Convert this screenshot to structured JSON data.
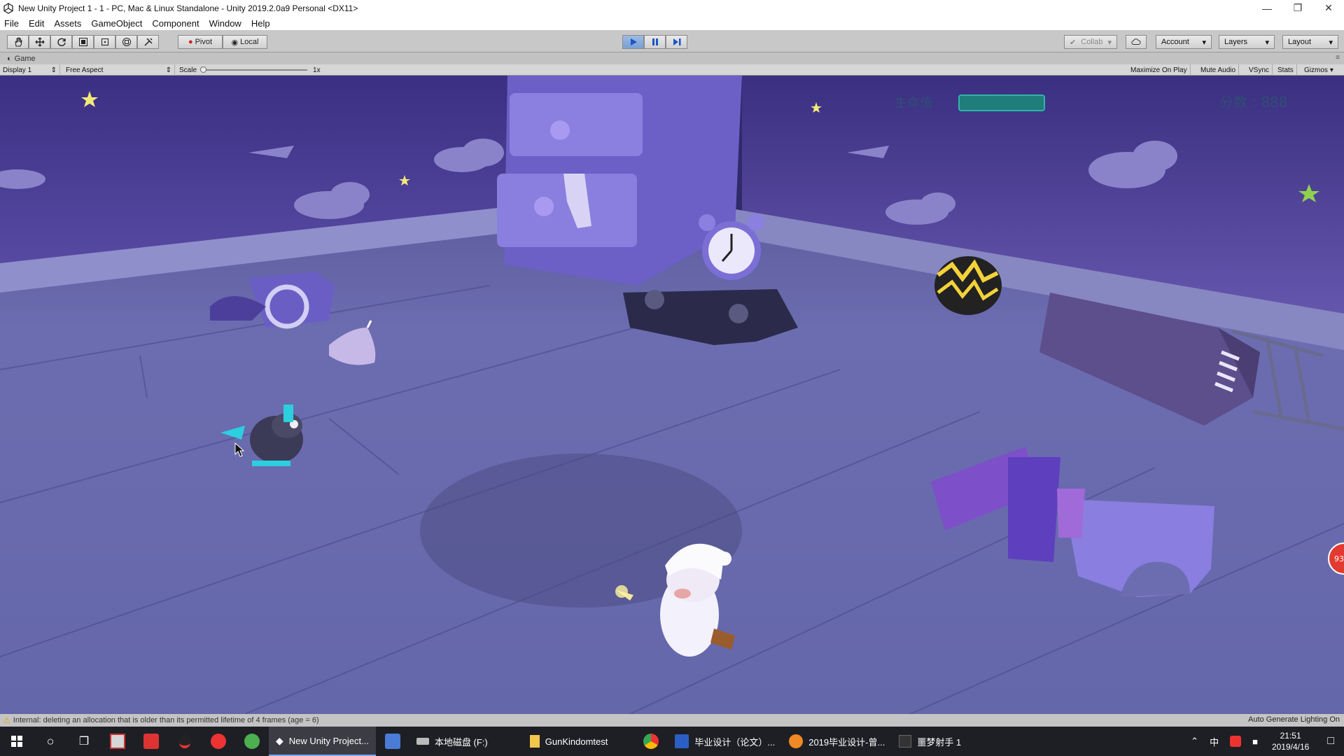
{
  "window": {
    "title": "New Unity Project 1 - 1 - PC, Mac & Linux Standalone - Unity 2019.2.0a9 Personal <DX11>",
    "minimize_icon": "minimize-icon",
    "restore_icon": "restore-icon",
    "close_icon": "close-icon"
  },
  "menu": [
    "File",
    "Edit",
    "Assets",
    "GameObject",
    "Component",
    "Window",
    "Help"
  ],
  "toolbar": {
    "pivot_label": "Pivot",
    "local_label": "Local",
    "collab_label": "Collab",
    "account_label": "Account",
    "layers_label": "Layers",
    "layout_label": "Layout"
  },
  "game_view": {
    "tab_label": "Game",
    "display_label": "Display 1",
    "aspect_label": "Free Aspect",
    "scale_label": "Scale",
    "scale_value": "1x",
    "maximize_label": "Maximize On Play",
    "mute_label": "Mute Audio",
    "vsync_label": "VSync",
    "stats_label": "Stats",
    "gizmos_label": "Gizmos",
    "hud": {
      "health_label": "生命值",
      "score_label": "分数 : 888",
      "side_badge": "93"
    }
  },
  "status": {
    "message": "Internal: deleting an allocation that is older than its permitted lifetime of 4 frames (age = 6)",
    "right_text": "Auto Generate Lighting On"
  },
  "taskbar": {
    "tasks": [
      {
        "label": "New Unity Project..."
      },
      {
        "label": "本地磁盘 (F:)"
      },
      {
        "label": "GunKindomtest"
      },
      {
        "label": "毕业设计（论文）..."
      },
      {
        "label": "2019毕业设计-曾..."
      },
      {
        "label": "噩梦射手 1"
      }
    ],
    "ime": "中",
    "time": "21:51",
    "date": "2019/4/16"
  },
  "colors": {
    "play_accent": "#3a7fd8",
    "wall": "#4b3f92",
    "floor": "#6c6fb0"
  }
}
